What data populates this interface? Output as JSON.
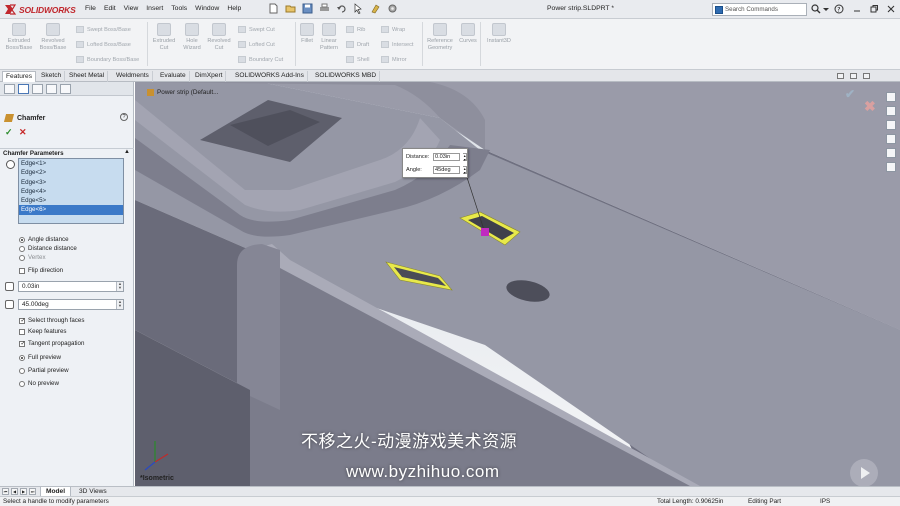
{
  "app": {
    "brand": "SOLIDWORKS",
    "doc_title": "Power strip.SLDPRT *"
  },
  "menus": [
    "File",
    "Edit",
    "View",
    "Insert",
    "Tools",
    "Window",
    "Help"
  ],
  "search": {
    "placeholder": "Search Commands"
  },
  "ribbon": {
    "extruded_boss": [
      "Extruded",
      "Boss/Base"
    ],
    "revolved_boss": [
      "Revolved",
      "Boss/Base"
    ],
    "sweep_boss": "Swept Boss/Base",
    "lofted_boss": "Lofted Boss/Base",
    "boundary_boss": "Boundary Boss/Base",
    "extruded_cut": [
      "Extruded",
      "Cut"
    ],
    "hole_wizard": [
      "Hole",
      "Wizard"
    ],
    "revolved_cut": [
      "Revolved",
      "Cut"
    ],
    "swept_cut": "Swept Cut",
    "lofted_cut": "Lofted Cut",
    "boundary_cut": "Boundary Cut",
    "fillet": "Fillet",
    "linear_pattern": [
      "Linear",
      "Pattern"
    ],
    "rib": "Rib",
    "draft": "Draft",
    "shell": "Shell",
    "wrap": "Wrap",
    "intersect": "Intersect",
    "mirror": "Mirror",
    "reference_geometry": [
      "Reference",
      "Geometry"
    ],
    "curves": "Curves",
    "instant3d": "Instant3D"
  },
  "tabs": [
    "Features",
    "Sketch",
    "Sheet Metal",
    "Weldments",
    "Evaluate",
    "DimXpert",
    "SOLIDWORKS Add-Ins",
    "SOLIDWORKS MBD"
  ],
  "panel": {
    "title": "Chamfer",
    "ok": "✓",
    "cancel": "✕",
    "section": "Chamfer Parameters",
    "edges": [
      "Edge<1>",
      "Edge<2>",
      "Edge<3>",
      "Edge<4>",
      "Edge<5>",
      "Edge<6>"
    ],
    "type_options": [
      "Angle distance",
      "Distance distance",
      "Vertex"
    ],
    "flip": "Flip direction",
    "distance": "0.03in",
    "angle": "45.00deg",
    "select_through": "Select through faces",
    "keep_features": "Keep features",
    "tangent": "Tangent propagation",
    "preview_options": [
      "Full preview",
      "Partial preview",
      "No preview"
    ]
  },
  "viewport": {
    "breadcrumb": "Power strip  (Default...",
    "callout_distance_label": "Distance:",
    "callout_distance": "0.03in",
    "callout_angle_label": "Angle:",
    "callout_angle": "45deg",
    "view_name": "*Isometric"
  },
  "bottom_tabs": [
    "Model",
    "3D Views"
  ],
  "status": {
    "hint": "Select a handle to modify parameters",
    "length": "Total Length: 0.90625in",
    "mode": "Editing Part",
    "units": "IPS"
  },
  "watermark": [
    "不移之火-动漫游戏美术资源",
    "www.byzhihuo.com"
  ],
  "colors": {
    "selection_yellow": "#e8e94a",
    "model_gray": "#9a9ba9",
    "accent_blue": "#3b79c8",
    "brand_red": "#c0272d"
  }
}
